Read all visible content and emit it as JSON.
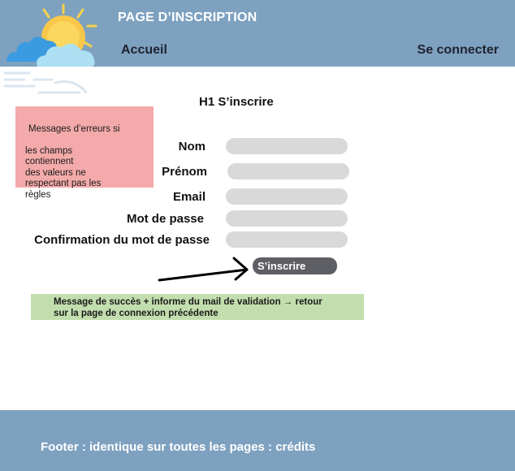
{
  "header": {
    "title": "PAGE D’INSCRIPTION",
    "nav": {
      "home_label": "Accueil",
      "login_label": "Se connecter"
    },
    "logo_icon": "weather-sun-cloud-icon",
    "colors": {
      "background": "#7ea1c0"
    }
  },
  "main": {
    "heading": "H1 S’inscrire",
    "error_note": {
      "line1": "Messages d’erreurs si",
      "rest": "les champs\ncontiennent\ndes valeurs ne\nrespectant pas les\nrègles",
      "color": "#f4aaaa"
    },
    "form": {
      "fields": [
        {
          "label": "Nom",
          "value": ""
        },
        {
          "label": "Prénom",
          "value": ""
        },
        {
          "label": "Email",
          "value": ""
        },
        {
          "label": "Mot de passe",
          "value": ""
        },
        {
          "label": "Confirmation du mot de passe",
          "value": ""
        }
      ],
      "submit_label": "S’inscrire"
    },
    "arrow_icon": "arrow-right-icon",
    "success_note": {
      "line1": "Message de succès + informe du mail  de validation → retour",
      "line2": "sur la page de connexion précédente",
      "color": "#c3deae"
    }
  },
  "footer": {
    "text": "Footer : identique sur toutes les pages : crédits"
  }
}
